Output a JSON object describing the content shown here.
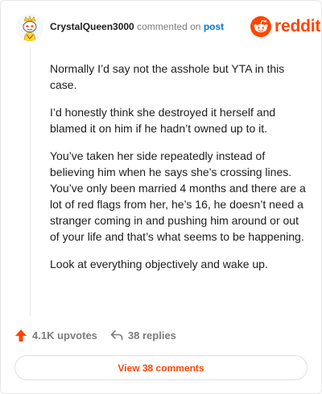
{
  "comment": {
    "username": "CrystalQueen3000",
    "action_text": "commented on",
    "post_link": "post",
    "paragraphs": [
      "Normally I’d say not the asshole but YTA in this case.",
      "I’d honestly think she destroyed it herself and blamed it on him if he hadn’t owned up to it.",
      "You’ve taken her side repeatedly instead of believing him when he says she’s crossing lines. You’ve only been married 4 months and there are a lot of red flags from her, he’s 16, he doesn’t need a stranger coming in and pushing him around or out of your life and that’s what seems to be happening.",
      "Look at everything objectively and wake up."
    ]
  },
  "brand": {
    "name": "reddit",
    "color": "#ff4500"
  },
  "actions": {
    "upvotes_label": "4.1K upvotes",
    "replies_label": "38 replies"
  },
  "view_button": {
    "label": "View 38 comments"
  },
  "icons": [
    "avatar-snoo-icon",
    "reddit-logo-icon",
    "upvote-arrow-icon",
    "reply-arrow-icon"
  ]
}
